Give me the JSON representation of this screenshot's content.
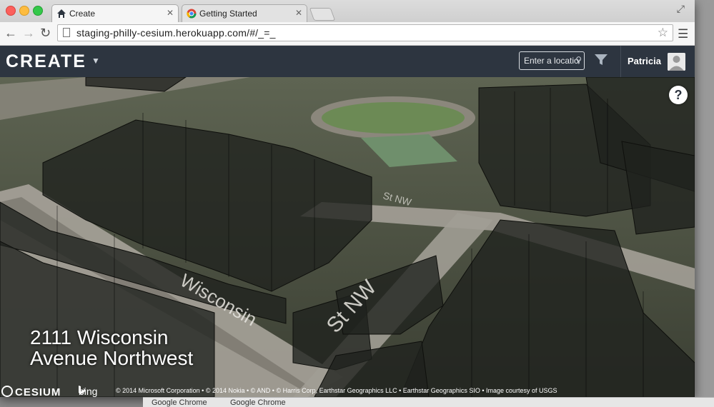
{
  "browser": {
    "tabs": [
      {
        "title": "Create",
        "active": true
      },
      {
        "title": "Getting Started",
        "active": false
      }
    ],
    "url": "staging-philly-cesium.herokuapp.com/#/_=_"
  },
  "header": {
    "brand": "CREATE",
    "search_placeholder": "Enter a location",
    "user_name": "Patricia"
  },
  "map": {
    "address_line1": "2111 Wisconsin",
    "address_line2": "Avenue Northwest",
    "help_label": "?",
    "cesium_label": "CESIUM",
    "bing_label": "bing",
    "attribution": "© 2014 Microsoft Corporation • © 2014 Nokia • © AND • © Harris Corp, Earthstar Geographics LLC • Earthstar Geographics SIO • Image courtesy of USGS"
  },
  "background_window": {
    "items": [
      "Google Chrome",
      "Google Chrome"
    ]
  },
  "colors": {
    "header_bg": "#2d3540",
    "accent": "#ffffff"
  }
}
